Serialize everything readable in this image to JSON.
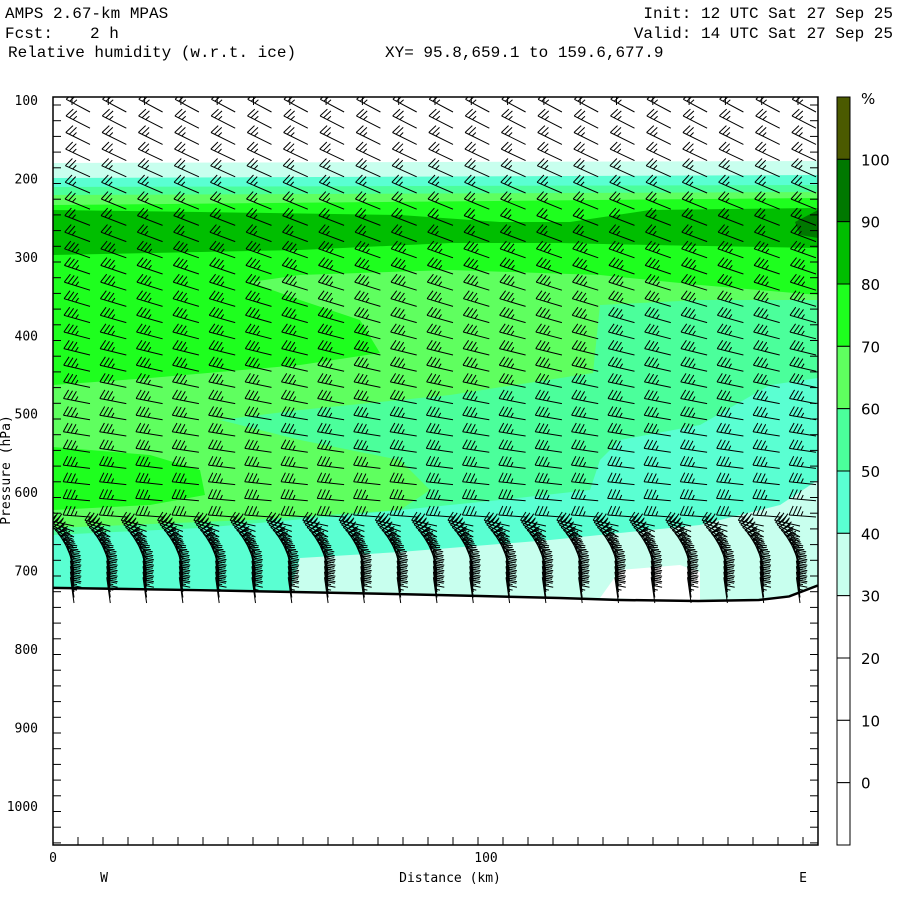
{
  "header": {
    "model": "AMPS 2.67-km MPAS",
    "init": "Init: 12 UTC Sat 27 Sep 25",
    "fcst_label": "Fcst:",
    "fcst_value": "2 h",
    "valid": "Valid: 14 UTC Sat 27 Sep 25",
    "field": "Relative humidity (w.r.t. ice)",
    "xy": "XY=  95.8,659.1 to 159.6,677.9"
  },
  "chart_data": {
    "type": "heatmap",
    "title": "Relative humidity (w.r.t. ice)",
    "xlabel": "Distance (km)",
    "ylabel": "Pressure (hPa)",
    "xlim": [
      0,
      176.6
    ],
    "ylim": [
      1050,
      96
    ],
    "xticks": [
      0,
      100
    ],
    "yticks": [
      100,
      200,
      300,
      400,
      500,
      600,
      700,
      800,
      900,
      1000
    ],
    "x_end_labels": {
      "left": "W",
      "right": "E"
    },
    "overlay": "wind barbs",
    "surface_km": [
      0,
      34,
      57,
      80,
      98.6,
      117,
      131,
      149,
      163,
      170,
      176.6
    ],
    "surface_hPa": [
      722,
      725,
      727.5,
      730,
      732.4,
      735,
      737.5,
      738.8,
      737.5,
      733,
      719
    ],
    "colorbar": {
      "unit": "%",
      "labels": [
        "100",
        "90",
        "80",
        "70",
        "60",
        "50",
        "40",
        "30",
        "20",
        "10",
        "0"
      ],
      "colors": [
        "#4b5a00",
        "#007800",
        "#00be00",
        "#1eff1e",
        "#5fff5f",
        "#4bff9b",
        "#5affd2",
        "#c8ffee",
        "#ffffff",
        "#ffffff",
        "#ffffff",
        "#ffffff"
      ]
    }
  }
}
